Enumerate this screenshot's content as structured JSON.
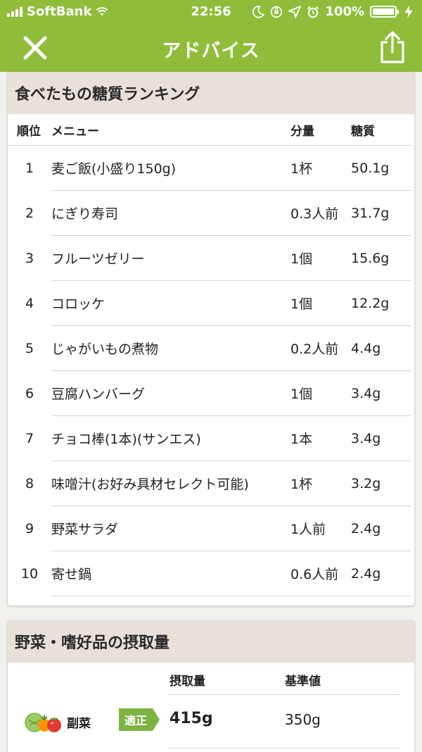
{
  "status_bar": {
    "carrier": "SoftBank",
    "time": "22:56",
    "battery_percent": "100%"
  },
  "nav": {
    "title": "アドバイス",
    "close_icon": "close-icon",
    "share_icon": "share-icon"
  },
  "ranking": {
    "title": "食べたもの糖質ランキング",
    "columns": {
      "rank": "順位",
      "menu": "メニュー",
      "amount": "分量",
      "carb": "糖質"
    },
    "rows": [
      {
        "rank": "1",
        "menu": "麦ご飯(小盛り150g)",
        "amount": "1杯",
        "carb": "50.1g"
      },
      {
        "rank": "2",
        "menu": "にぎり寿司",
        "amount": "0.3人前",
        "carb": "31.7g"
      },
      {
        "rank": "3",
        "menu": "フルーツゼリー",
        "amount": "1個",
        "carb": "15.6g"
      },
      {
        "rank": "4",
        "menu": "コロッケ",
        "amount": "1個",
        "carb": "12.2g"
      },
      {
        "rank": "5",
        "menu": "じゃがいもの煮物",
        "amount": "0.2人前",
        "carb": "4.4g"
      },
      {
        "rank": "6",
        "menu": "豆腐ハンバーグ",
        "amount": "1個",
        "carb": "3.4g"
      },
      {
        "rank": "7",
        "menu": "チョコ棒(1本)(サンエス)",
        "amount": "1本",
        "carb": "3.4g"
      },
      {
        "rank": "8",
        "menu": "味噌汁(お好み具材セレクト可能)",
        "amount": "1杯",
        "carb": "3.2g"
      },
      {
        "rank": "9",
        "menu": "野菜サラダ",
        "amount": "1人前",
        "carb": "2.4g"
      },
      {
        "rank": "10",
        "menu": "寄せ鍋",
        "amount": "0.6人前",
        "carb": "2.4g"
      }
    ]
  },
  "intake": {
    "title": "野菜・嗜好品の摂取量",
    "columns": {
      "intake": "摂取量",
      "standard": "基準値"
    },
    "rows": [
      {
        "icon": "vegetables-icon",
        "label": "副菜",
        "badge": "適正",
        "value": "415g",
        "standard": "350g"
      }
    ]
  },
  "colors": {
    "header_green": "#8fbd3a",
    "badge_green": "#7cb342",
    "section_header": "#e9e0d9"
  }
}
